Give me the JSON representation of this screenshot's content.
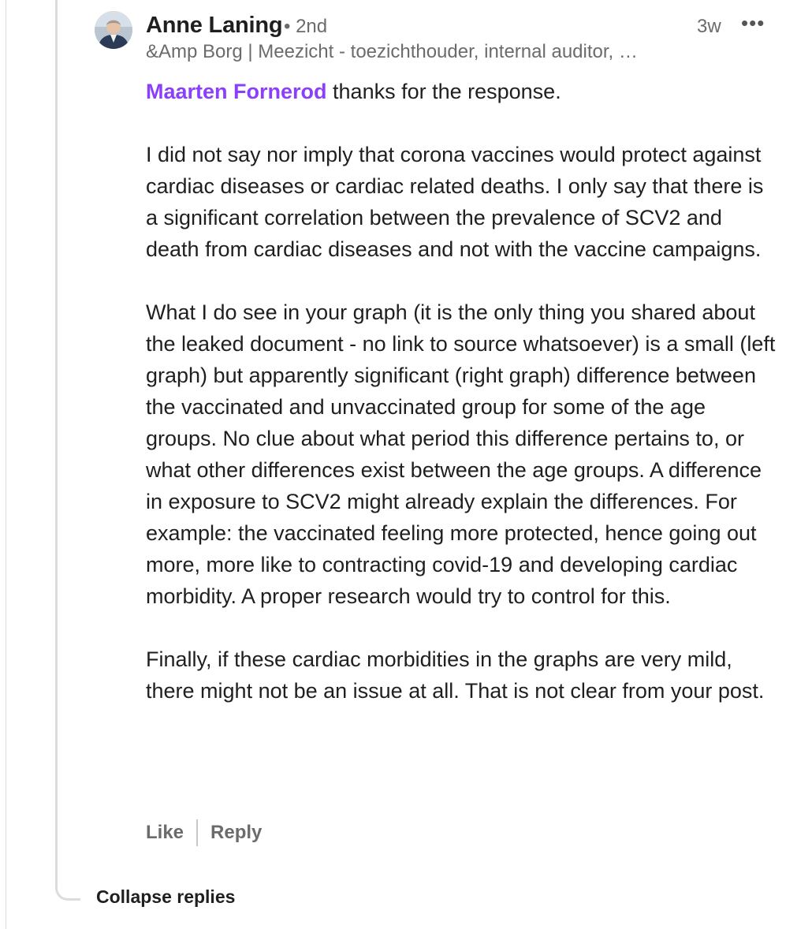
{
  "comment": {
    "author_name": "Anne Laning",
    "degree": "• 2nd",
    "time_ago": "3w",
    "more_label": "•••",
    "headline": "&Amp Borg | Meezicht - toezichthouder, internal auditor, …",
    "mention": "Maarten Fornerod",
    "first_line_rest": " thanks for the response.",
    "paragraphs": [
      "I did not say nor imply that corona vaccines would protect against cardiac diseases or cardiac related deaths. I only say that there is a significant correlation between the prevalence of SCV2 and death from cardiac diseases and not with the vaccine campaigns.",
      "What I do see in your graph (it is the only thing you shared about the leaked document - no link to source whatsoever) is a small (left graph) but apparently significant (right graph) difference between the vaccinated and unvaccinated group for some of the age groups. No clue about what period this difference pertains to, or what other differences exist between the age groups. A difference in exposure to SCV2 might already explain the differences. For example: the vaccinated feeling more protected, hence going out more, more like to contracting covid-19 and developing cardiac morbidity. A proper research would try to control for this.",
      "Finally, if these cardiac morbidities in the graphs are very mild, there might not be an issue at all. That is not clear from your post."
    ]
  },
  "actions": {
    "like_label": "Like",
    "reply_label": "Reply"
  },
  "thread": {
    "collapse_label": "Collapse replies"
  }
}
